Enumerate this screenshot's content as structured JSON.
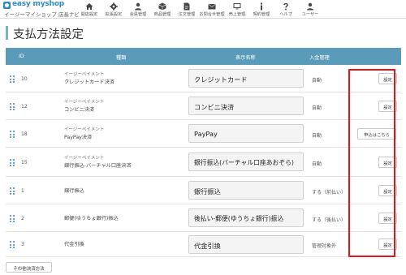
{
  "header": {
    "brand": "easy myshop",
    "subtitle": "イージーマイショップ 店長ナビ",
    "nav": [
      {
        "label": "開店設定",
        "icon": "home-icon"
      },
      {
        "label": "拡張設定",
        "icon": "gear-icon"
      },
      {
        "label": "会員管理",
        "icon": "person-icon"
      },
      {
        "label": "商品管理",
        "icon": "box-icon"
      },
      {
        "label": "注文管理",
        "icon": "document-icon"
      },
      {
        "label": "お問合せ管理",
        "icon": "envelope-icon"
      },
      {
        "label": "売上管理",
        "icon": "monitor-icon"
      },
      {
        "label": "契約管理",
        "icon": "info-icon"
      },
      {
        "label": "ヘルプ",
        "icon": "question-icon"
      },
      {
        "label": "ユーザー",
        "icon": "user-icon"
      }
    ]
  },
  "page": {
    "title": "支払方法設定"
  },
  "table": {
    "headers": {
      "id": "ID",
      "type": "種類",
      "display": "表示名称",
      "income": "入金管理"
    },
    "rows": [
      {
        "id": "10",
        "provider": "イージーペイメント",
        "type": "クレジットカード決済",
        "display": "クレジットカード",
        "income": "自動",
        "button": "設定"
      },
      {
        "id": "12",
        "provider": "イージーペイメント",
        "type": "コンビニ決済",
        "display": "コンビニ決済",
        "income": "自動",
        "button": "設定"
      },
      {
        "id": "18",
        "provider": "イージーペイメント",
        "type": "PayPay決済",
        "display": "PayPay",
        "income": "自動",
        "button": "申込はこちら"
      },
      {
        "id": "15",
        "provider": "イージーペイメント",
        "type": "銀行振込-バーチャル口座決済",
        "display": "銀行振込(バーチャル口座あおぞら)",
        "income": "自動",
        "button": "設定"
      },
      {
        "id": "1",
        "provider": "",
        "type": "銀行振込",
        "display": "銀行振込",
        "income": "する（前払い）",
        "button": "設定"
      },
      {
        "id": "2",
        "provider": "",
        "type": "郵便(ゆうちょ銀行)振込",
        "display": "後払い-郵便(ゆうちょ銀行)振込",
        "income": "する（後払い）",
        "button": "設定"
      },
      {
        "id": "3",
        "provider": "",
        "type": "代金引換",
        "display": "代金引換",
        "income": "管理対象外",
        "button": "設定"
      }
    ]
  },
  "footer": {
    "other_button": "その他決済方法"
  },
  "colors": {
    "accent": "#5a9bb9",
    "brand": "#2e8bc9",
    "highlight": "#e0151c"
  }
}
